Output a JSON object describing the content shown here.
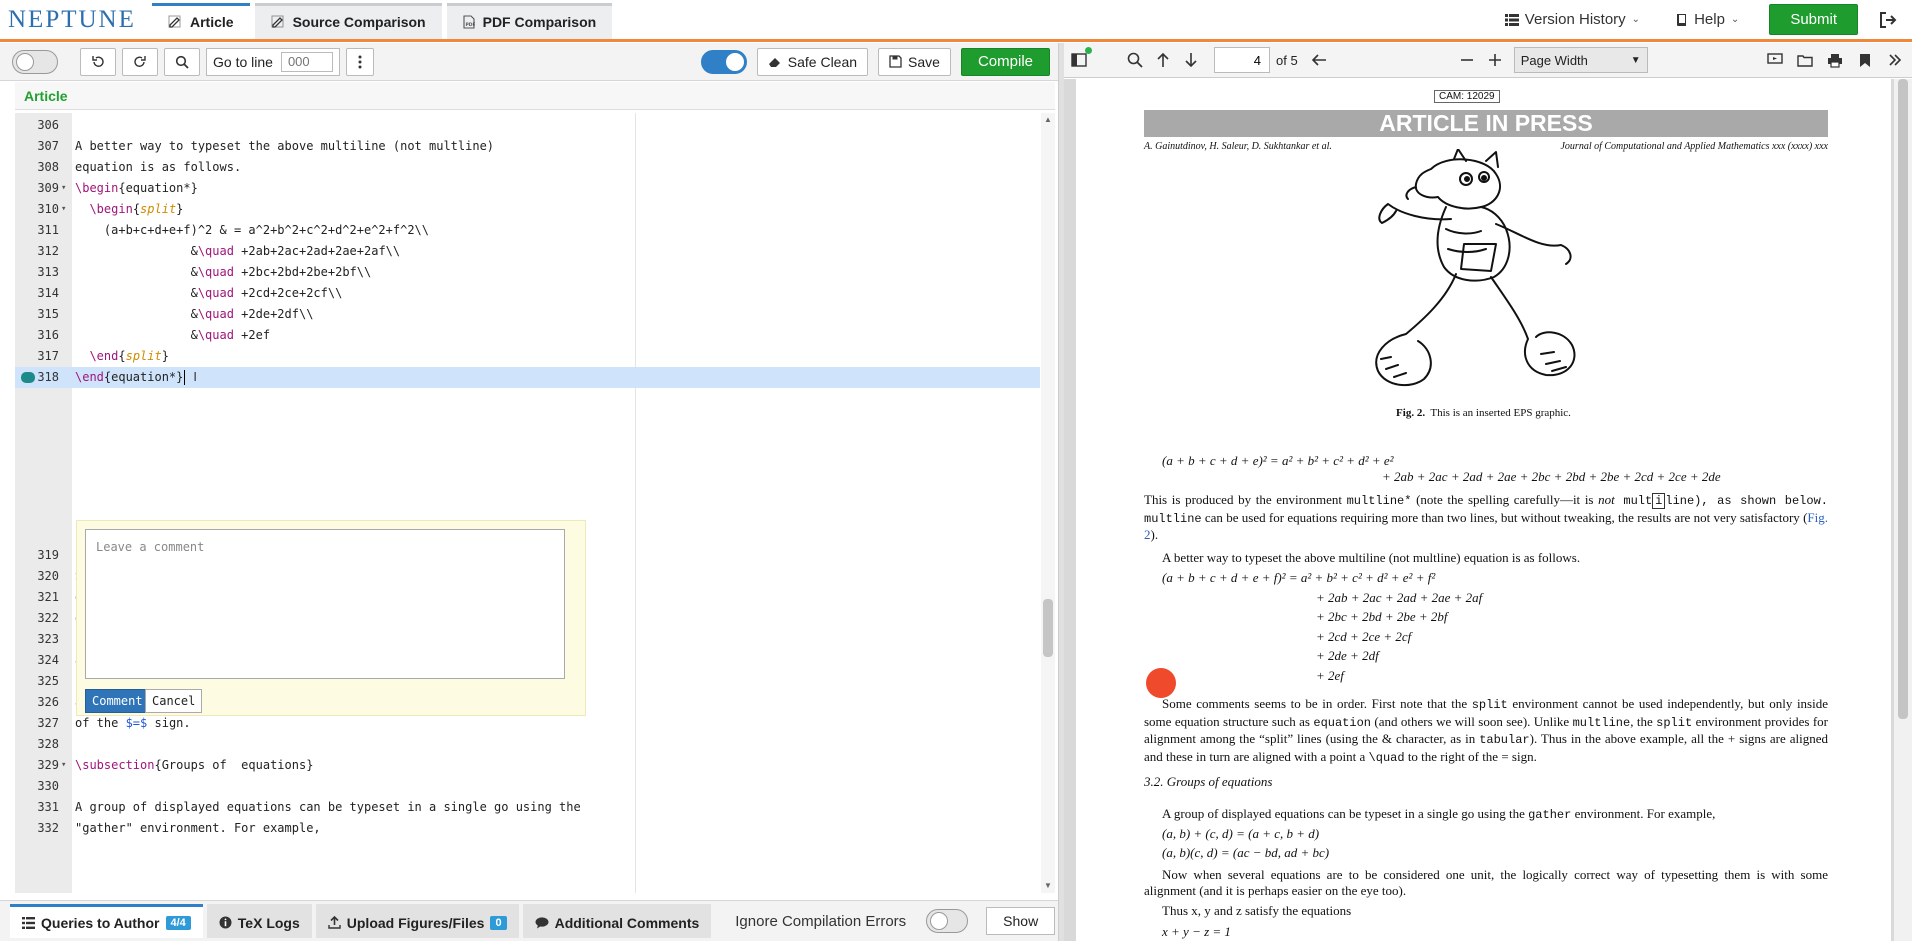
{
  "app": {
    "logo": "NEPTUNE"
  },
  "top_tabs": [
    {
      "label": "Article"
    },
    {
      "label": "Source Comparison"
    },
    {
      "label": "PDF Comparison"
    }
  ],
  "top_right": {
    "version_history": "Version History",
    "help": "Help",
    "submit": "Submit"
  },
  "editor_toolbar": {
    "goto_label": "Go to line",
    "goto_placeholder": "000",
    "safe_clean": "Safe Clean",
    "save": "Save",
    "compile": "Compile"
  },
  "article_label": "Article",
  "editor_lines": [
    {
      "n": "306",
      "fold": "",
      "text": ""
    },
    {
      "n": "307",
      "fold": "",
      "text": "A better way to typeset the above multiline (not multline)"
    },
    {
      "n": "308",
      "fold": "",
      "text": "equation is as follows."
    },
    {
      "n": "309",
      "fold": "▾",
      "text": "\\begin{equation*}"
    },
    {
      "n": "310",
      "fold": "▾",
      "text": "  \\begin{split}"
    },
    {
      "n": "311",
      "fold": "",
      "text": "    (a+b+c+d+e+f)^2 & = a^2+b^2+c^2+d^2+e^2+f^2\\\\"
    },
    {
      "n": "312",
      "fold": "",
      "text": "                &\\quad +2ab+2ac+2ad+2ae+2af\\\\"
    },
    {
      "n": "313",
      "fold": "",
      "text": "                &\\quad +2bc+2bd+2be+2bf\\\\"
    },
    {
      "n": "314",
      "fold": "",
      "text": "                &\\quad +2cd+2ce+2cf\\\\"
    },
    {
      "n": "315",
      "fold": "",
      "text": "                &\\quad +2de+2df\\\\"
    },
    {
      "n": "316",
      "fold": "",
      "text": "                &\\quad +2ef"
    },
    {
      "n": "317",
      "fold": "",
      "text": "  \\end{split}"
    },
    {
      "n": "318",
      "fold": "",
      "text": "\\end{equation*}"
    },
    {
      "n": "319",
      "fold": "",
      "text": ""
    },
    {
      "n": "320",
      "fold": "",
      "text": "Some comments seems to be in order. First note that the \"split\""
    },
    {
      "n": "321",
      "fold": "",
      "text": "environment cannot be used independently, but only inside some"
    },
    {
      "n": "322",
      "fold": "",
      "text": "equation structure such as \"equation\" (and others we will soon"
    },
    {
      "n": "323",
      "fold": "",
      "text": "see). Unlike \"multline\", the \"split\" environment provides for"
    },
    {
      "n": "324",
      "fold": "",
      "text": "alignment among the ``split'' lines (using the \\& character, as in"
    },
    {
      "n": "325",
      "fold": "",
      "text": "\"tabular\"). Thus in the above example, all the $+$ signs are aligned"
    },
    {
      "n": "326",
      "fold": "",
      "text": "and these in turn are aligned with a point a \"\\quad\" to the right"
    },
    {
      "n": "327",
      "fold": "",
      "text": "of the $=$ sign."
    },
    {
      "n": "328",
      "fold": "",
      "text": ""
    },
    {
      "n": "329",
      "fold": "▾",
      "text": "\\subsection{Groups of  equations}"
    },
    {
      "n": "330",
      "fold": "",
      "text": ""
    },
    {
      "n": "331",
      "fold": "",
      "text": "A group of displayed equations can be typeset in a single go using the"
    },
    {
      "n": "332",
      "fold": "",
      "text": "\"gather\" environment. For example,"
    }
  ],
  "comment_box": {
    "placeholder": "Leave a comment",
    "comment_btn": "Comment",
    "cancel_btn": "Cancel"
  },
  "bottom_tabs": [
    {
      "label": "Queries to Author",
      "badge": "4/4"
    },
    {
      "label": "TeX Logs",
      "badge": ""
    },
    {
      "label": "Upload Figures/Files",
      "badge": "0"
    },
    {
      "label": "Additional Comments",
      "badge": ""
    }
  ],
  "bottom_bar": {
    "ignore_errors": "Ignore Compilation Errors",
    "show": "Show"
  },
  "pdf_toolbar": {
    "page_current": "4",
    "page_total": "of 5",
    "zoom": "Page Width"
  },
  "pdf": {
    "cam": "CAM: 12029",
    "banner": "ARTICLE IN PRESS",
    "authors": "A. Gainutdinov, H. Saleur, D. Sukhtankar et al.",
    "journal": "Journal of Computational and Applied Mathematics xxx (xxxx) xxx",
    "fig_caption_label": "Fig. 2.",
    "fig_caption_text": "This is an inserted EPS graphic.",
    "eq1_line1": "(a + b + c + d + e)² = a² + b² + c² + d² + e²",
    "eq1_line2": "+ 2ab + 2ac + 2ad + 2ae + 2bc + 2bd + 2be + 2cd + 2ce + 2de",
    "para1_a": "This is produced by the environment ",
    "para1_b": "multline*",
    "para1_c": " (note the spelling carefully—it is ",
    "para1_d": "not",
    "para1_e": " mult",
    "para1_f": "i",
    "para1_g": "line), as shown below.",
    "para1_h": "multline",
    "para1_i": " can be used for equations requiring more than two lines, but without tweaking, the results are not very satisfactory (",
    "para1_link": "Fig. 2",
    "para1_j": ").",
    "para2": "A better way to typeset the above multiline (not multline) equation is as follows.",
    "eq2": [
      "(a + b + c + d + e + f)² = a² + b² + c² + d² + e² + f²",
      "+ 2ab + 2ac + 2ad + 2ae + 2af",
      "+ 2bc + 2bd + 2be + 2bf",
      "+ 2cd + 2ce + 2cf",
      "+ 2de + 2df",
      "+ 2ef"
    ],
    "para3_a": "Some comments seems to be in order. First note that the ",
    "para3_split": "split",
    "para3_b": " environment cannot be used independently, but only inside some equation structure such as ",
    "para3_equation": "equation",
    "para3_c": " (and others we will soon see). Unlike ",
    "para3_multline": "multline",
    "para3_d": ", the ",
    "para3_split2": "split",
    "para3_e": " environment provides for alignment among the “split” lines (using the & character, as in ",
    "para3_tabular": "tabular",
    "para3_f": "). Thus in the above example, all the + signs are aligned and these in turn are aligned with a point a ",
    "para3_quad": "\\quad",
    "para3_g": " to the right of the = sign.",
    "section": "3.2.  Groups of equations",
    "para4_a": "A group of displayed equations can be typeset in a single go using the ",
    "para4_gather": "gather",
    "para4_b": " environment. For example,",
    "eq3_1": "(a, b) + (c, d) = (a + c, b + d)",
    "eq3_2": "(a, b)(c, d) = (ac − bd, ad + bc)",
    "para5": "Now when several equations are to be considered one unit, the logically correct way of typesetting them is with some alignment (and it is perhaps easier on the eye too).",
    "para6": "Thus x, y and z satisfy the equations",
    "eq4": "x + y − z = 1"
  }
}
